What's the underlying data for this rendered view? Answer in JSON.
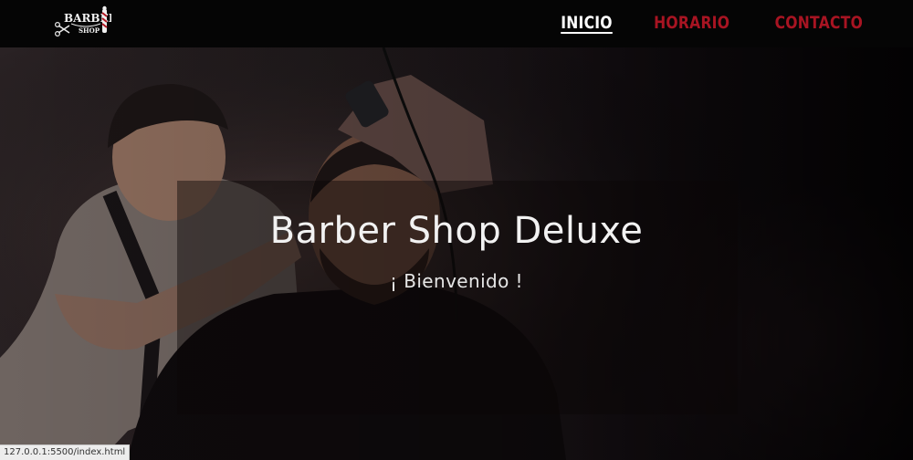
{
  "brand": {
    "logo_text_top": "BARBER",
    "logo_text_bottom": "SHOP"
  },
  "nav": {
    "items": [
      {
        "label": "INICIO",
        "active": true
      },
      {
        "label": "HORARIO",
        "active": false
      },
      {
        "label": "CONTACTO",
        "active": false
      }
    ]
  },
  "hero": {
    "title": "Barber Shop Deluxe",
    "subtitle": "¡ Bienvenido !"
  },
  "status_bar": {
    "url": "127.0.0.1:5500/index.html"
  },
  "colors": {
    "nav_background": "#050505",
    "nav_active": "#ffffff",
    "nav_inactive": "#a81422",
    "hero_text": "#f2f2f2"
  }
}
